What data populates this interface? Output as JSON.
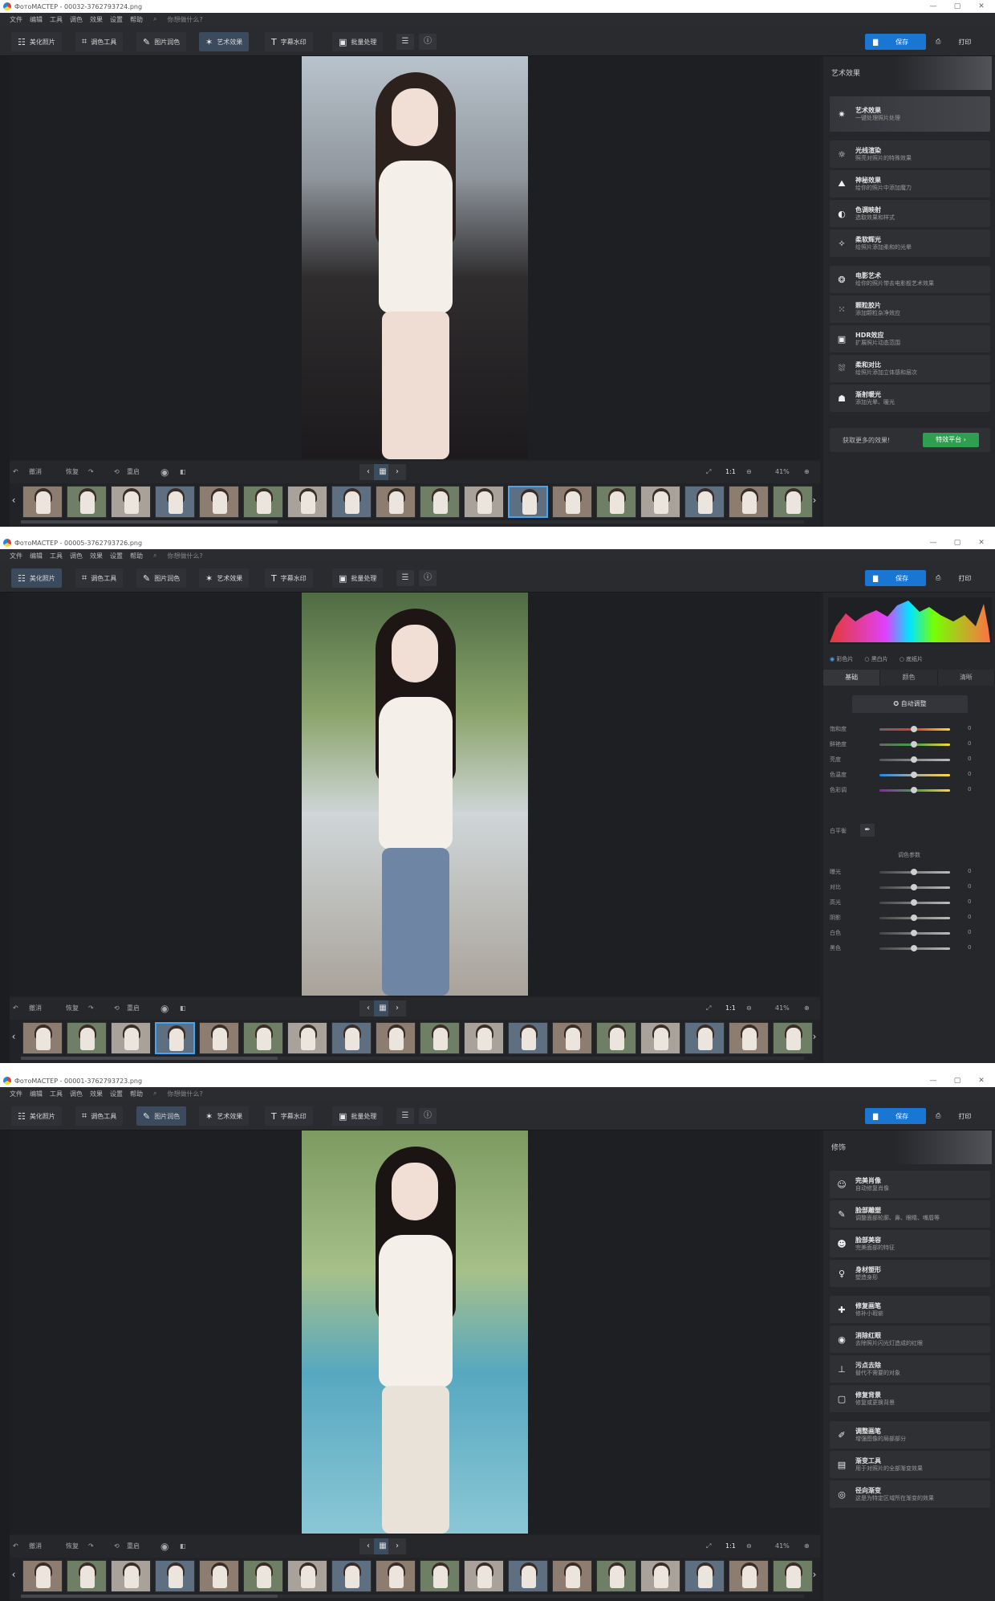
{
  "windows": [
    {
      "title": "ФотоМАСТЕР - 00032-3762793724.png",
      "panel_type": "effects",
      "active_tab": 3,
      "selected_thumb": 11,
      "photo_theme": "sofa"
    },
    {
      "title": "ФотоМАСТЕР - 00005-3762793726.png",
      "panel_type": "enhance",
      "active_tab": 0,
      "selected_thumb": 3,
      "photo_theme": "park"
    },
    {
      "title": "ФотоМАСТЕР - 00001-3762793723.png",
      "panel_type": "retouch",
      "active_tab": 2,
      "selected_thumb": -1,
      "photo_theme": "pool"
    }
  ],
  "menu": [
    "文件",
    "编辑",
    "工具",
    "调色",
    "效果",
    "设置",
    "帮助"
  ],
  "search_placeholder": "你想做什么?",
  "toolbar_tabs": [
    {
      "label": "美化照片",
      "icon": "sliders-icon"
    },
    {
      "label": "调色工具",
      "icon": "crop-icon"
    },
    {
      "label": "图片润色",
      "icon": "brush-icon"
    },
    {
      "label": "艺术效果",
      "icon": "magic-wand-icon"
    },
    {
      "label": "字幕水印",
      "icon": "text-icon"
    },
    {
      "label": "批量处理",
      "icon": "image-icon"
    }
  ],
  "save_label": "保存",
  "print_label": "打印",
  "bottom": {
    "undo": "撤消",
    "reset": "恢复",
    "restore": "重启",
    "zoom_1to1": "1:1",
    "zoom_value": "41%"
  },
  "panels": {
    "effects": {
      "header": "艺术效果",
      "items": [
        {
          "title": "艺术效果",
          "desc": "一键处理照片处理",
          "icon": "✷",
          "big": true
        },
        {
          "title": "光线渲染",
          "desc": "照亮对照片的特殊效果",
          "icon": "☼"
        },
        {
          "title": "神秘效果",
          "desc": "给你的照片中添加魔力",
          "icon": "⛰"
        },
        {
          "title": "色调映射",
          "desc": "选取效果和样式",
          "icon": "◐"
        },
        {
          "title": "柔软辉光",
          "desc": "给照片添加柔和的光晕",
          "icon": "✧"
        },
        {
          "title": "电影艺术",
          "desc": "给你的照片带去电影般艺术效果",
          "icon": "❂"
        },
        {
          "title": "颗粒胶片",
          "desc": "添加颗粒杂净效应",
          "icon": "⁙"
        },
        {
          "title": "HDR效应",
          "desc": "扩展照片动态范围",
          "icon": "▣"
        },
        {
          "title": "柔和对比",
          "desc": "给照片添加立体感和层次",
          "icon": "⛆"
        },
        {
          "title": "渐射暖光",
          "desc": "添加光晕、暖光",
          "icon": "☗"
        }
      ],
      "promo_text": "获取更多的效果!",
      "promo_button": "特效平台 ›"
    },
    "enhance": {
      "modes": [
        "彩色片",
        "黑白片",
        "底纸片"
      ],
      "tabs": [
        "基础",
        "颜色",
        "清晰"
      ],
      "auto_label": "自动调整",
      "sliders1": [
        {
          "label": "饱和度",
          "value": "0",
          "color": "linear-gradient(90deg,#666,#e53935,#fdd835)"
        },
        {
          "label": "鲜艳度",
          "value": "0",
          "color": "linear-gradient(90deg,#666,#43a047,#fdd835)"
        },
        {
          "label": "亮度",
          "value": "0",
          "color": "linear-gradient(90deg,#555,#bbb)"
        },
        {
          "label": "色温度",
          "value": "0",
          "color": "linear-gradient(90deg,#1e88e5,#aaa,#fdd835)"
        },
        {
          "label": "色彩调",
          "value": "0",
          "color": "linear-gradient(90deg,#8e24aa,#43a047,#fdd835)"
        }
      ],
      "white_balance_label": "白平衡",
      "section2_title": "调色参数",
      "sliders2": [
        {
          "label": "曝光",
          "value": "0"
        },
        {
          "label": "对比",
          "value": "0"
        },
        {
          "label": "高光",
          "value": "0"
        },
        {
          "label": "阴影",
          "value": "0"
        },
        {
          "label": "白色",
          "value": "0"
        },
        {
          "label": "黑色",
          "value": "0"
        }
      ]
    },
    "retouch": {
      "header": "修饰",
      "items": [
        {
          "title": "完美肖像",
          "desc": "自动修复肖像",
          "icon": "☺"
        },
        {
          "title": "脸部雕塑",
          "desc": "调整面部轮廓、鼻、眼睛、嘴唇等",
          "icon": "✎"
        },
        {
          "title": "脸部美容",
          "desc": "完美面部的特征",
          "icon": "☻"
        },
        {
          "title": "身材塑形",
          "desc": "塑造身形",
          "icon": "♀"
        },
        {
          "title": "修复画笔",
          "desc": "修补小瑕疵",
          "icon": "✚"
        },
        {
          "title": "消除红眼",
          "desc": "去除照片闪光灯造成的红眼",
          "icon": "◉"
        },
        {
          "title": "污点去除",
          "desc": "替代不需要的对象",
          "icon": "⊥"
        },
        {
          "title": "修复背景",
          "desc": "修复或更换背景",
          "icon": "▢"
        },
        {
          "title": "调整画笔",
          "desc": "增强图像的局部部分",
          "icon": "✐"
        },
        {
          "title": "渐变工具",
          "desc": "用于对照片的全部渐变效果",
          "icon": "▤"
        },
        {
          "title": "径向渐变",
          "desc": "这是为特定区域所在渐变的效果",
          "icon": "◎"
        }
      ]
    }
  },
  "thumb_count": 18,
  "colors": {
    "accent": "#1976d2",
    "bg": "#202124",
    "panel": "#26272b",
    "promo_green": "#2e9e4f"
  }
}
